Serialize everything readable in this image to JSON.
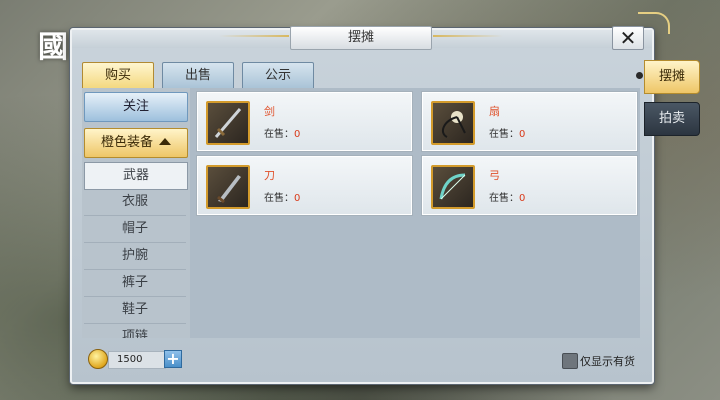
{
  "logo": {
    "text": "國教學院"
  },
  "window": {
    "title": "摆摊",
    "close_glyph": "✕"
  },
  "tabs": [
    {
      "label": "购买",
      "active": true
    },
    {
      "label": "出售",
      "active": false
    },
    {
      "label": "公示",
      "active": false
    }
  ],
  "sidebar": {
    "focus_label": "关注",
    "category_label": "橙色装备",
    "subcategories": [
      "武器",
      "衣服",
      "帽子",
      "护腕",
      "裤子",
      "鞋子",
      "项链"
    ],
    "selected_index": 0
  },
  "items": [
    {
      "name": "剑",
      "stock_label": "在售：",
      "stock": "0",
      "icon": "sword-icon"
    },
    {
      "name": "扇",
      "stock_label": "在售：",
      "stock": "0",
      "icon": "fan-icon"
    },
    {
      "name": "刀",
      "stock_label": "在售：",
      "stock": "0",
      "icon": "blade-icon"
    },
    {
      "name": "弓",
      "stock_label": "在售：",
      "stock": "0",
      "icon": "bow-icon"
    }
  ],
  "footer": {
    "money": "1500",
    "plus_glyph": "+",
    "only_in_stock_label": "仅显示有货"
  },
  "side_tabs": [
    {
      "label": "摆摊",
      "active": true
    },
    {
      "label": "拍卖",
      "active": false
    }
  ],
  "colors": {
    "accent_gold": "#eec667",
    "price_red": "#d93a1a",
    "item_name": "#e0522c"
  }
}
